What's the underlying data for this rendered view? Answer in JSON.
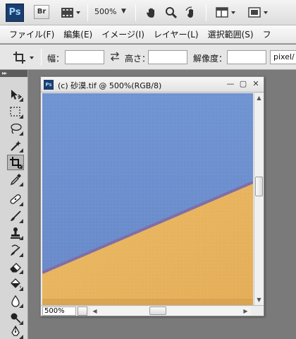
{
  "appbar": {
    "logo": "Ps",
    "bridge": "Br",
    "zoom": "500%",
    "icons": [
      "film-icon",
      "hand-icon",
      "zoom-icon",
      "rotate-view-icon",
      "arrange-documents-icon",
      "screen-mode-icon"
    ]
  },
  "menubar": {
    "items": [
      "ファイル(F)",
      "編集(E)",
      "イメージ(I)",
      "レイヤー(L)",
      "選択範囲(S)",
      "フ"
    ]
  },
  "options": {
    "width_label": "幅：",
    "width_value": "",
    "height_label": "高さ：",
    "height_value": "",
    "resolution_label": "解像度：",
    "resolution_value": "",
    "unit": "pixel/"
  },
  "tools": {
    "active": "crop-tool",
    "items": [
      "move-tool",
      "marquee-tool",
      "lasso-tool",
      "quick-select-tool",
      "crop-tool",
      "eyedropper-tool",
      "healing-brush-tool",
      "brush-tool",
      "clone-stamp-tool",
      "history-brush-tool",
      "eraser-tool",
      "paint-bucket-tool",
      "blur-tool",
      "dodge-tool",
      "pen-tool"
    ]
  },
  "document": {
    "title": "(c) 砂漠.tif @ 500%(RGB/8)",
    "zoom": "500%",
    "colors": {
      "sky": "#6c8fcf",
      "sand": "#e6b25c",
      "edge": "#7d6da5"
    }
  }
}
